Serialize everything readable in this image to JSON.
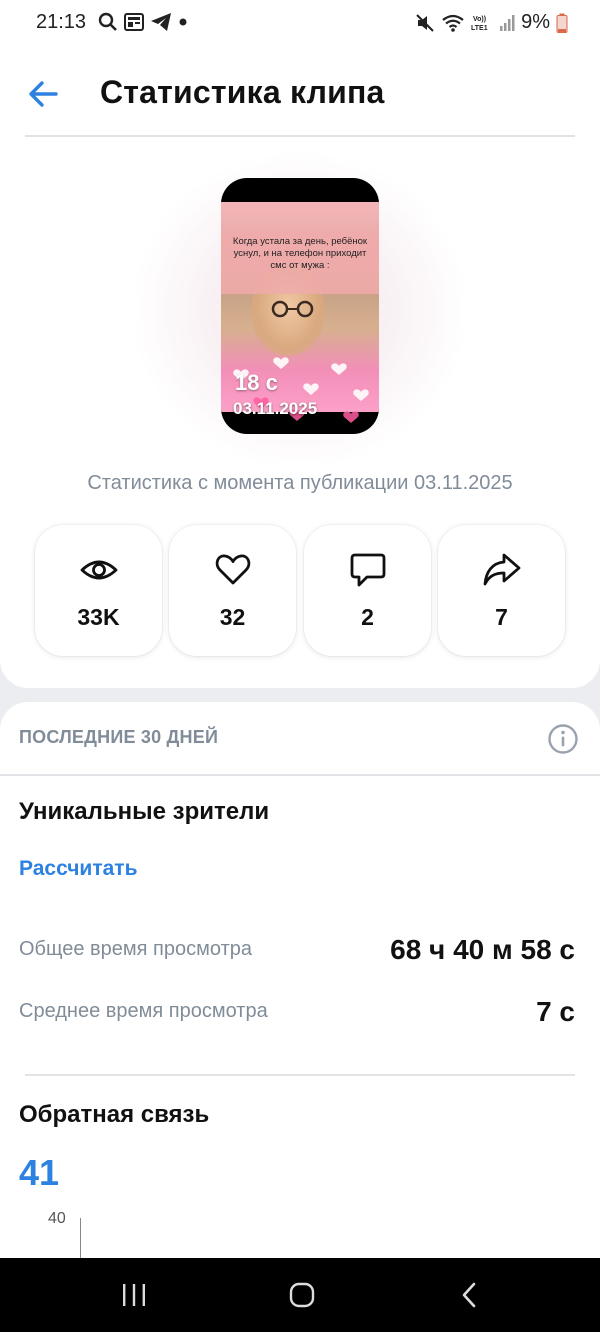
{
  "status_bar": {
    "time": "21:13",
    "battery": "9%",
    "icons": [
      "search-icon",
      "news-icon",
      "telegram-icon",
      "dot-icon",
      "mute-icon",
      "wifi-icon",
      "volte-icon",
      "signal-icon",
      "battery-icon"
    ]
  },
  "header": {
    "title": "Статистика клипа",
    "back_icon": "arrow-left-icon"
  },
  "clip": {
    "caption": "Когда устала за день, ребёнок уснул, и на телефон приходит смс от мужа :",
    "duration": "18 с",
    "date": "03.11.2025"
  },
  "since_text": "Статистика с момента публикации 03.11.2025",
  "stats": [
    {
      "icon": "eye-icon",
      "value": "33K"
    },
    {
      "icon": "heart-icon",
      "value": "32"
    },
    {
      "icon": "comment-icon",
      "value": "2"
    },
    {
      "icon": "share-icon",
      "value": "7"
    }
  ],
  "last30": {
    "label": "ПОСЛЕДНИЕ 30 ДНЕЙ",
    "unique_viewers_title": "Уникальные зрители",
    "calculate_link": "Рассчитать",
    "metrics": [
      {
        "label": "Общее время просмотра",
        "value": "68 ч 40 м 58 с"
      },
      {
        "label": "Среднее время просмотра",
        "value": "7 с"
      }
    ]
  },
  "feedback": {
    "title": "Обратная связь",
    "value": "41",
    "axis_tick": "40"
  },
  "colors": {
    "accent": "#2d81e0",
    "secondary_text": "#818c99",
    "background": "#ebedf0"
  }
}
